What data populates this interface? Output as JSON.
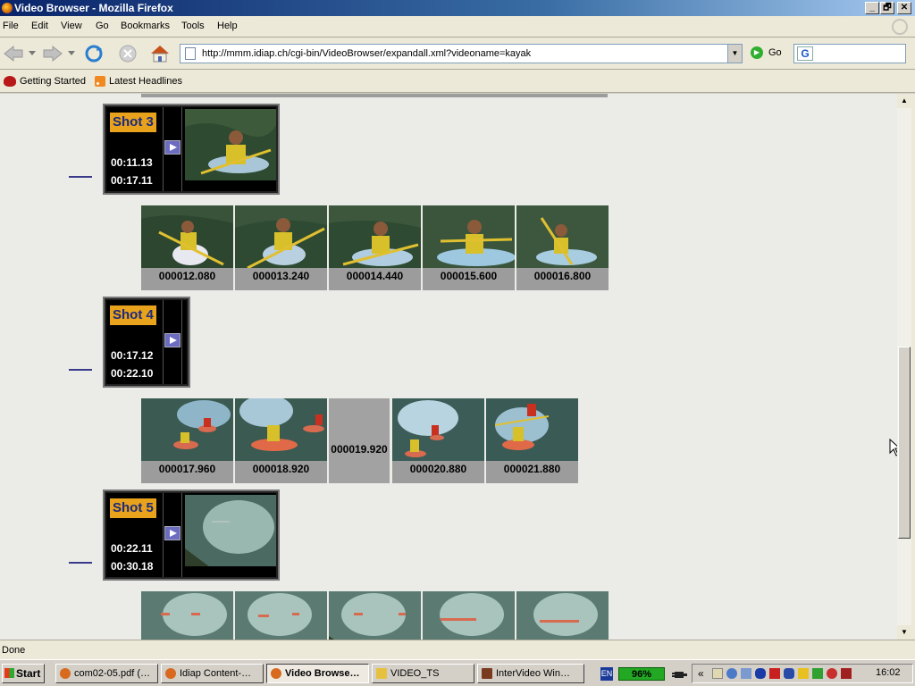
{
  "window": {
    "title": "Video Browser - Mozilla Firefox",
    "min_label": "_",
    "max_label": "🗗",
    "close_label": "✕"
  },
  "menu": [
    "File",
    "Edit",
    "View",
    "Go",
    "Bookmarks",
    "Tools",
    "Help"
  ],
  "nav": {
    "url": "http://mmm.idiap.ch/cgi-bin/VideoBrowser/expandall.xml?videoname=kayak",
    "go_label": "Go",
    "search_value": ""
  },
  "bookmarks": [
    "Getting Started",
    "Latest Headlines"
  ],
  "shots": [
    {
      "label": "Shot 3",
      "start": "00:11.13",
      "end": "00:17.11",
      "has_thumb": true,
      "frames": [
        "000012.080",
        "000013.240",
        "000014.440",
        "000015.600",
        "000016.800"
      ]
    },
    {
      "label": "Shot 4",
      "start": "00:17.12",
      "end": "00:22.10",
      "has_thumb": false,
      "frames": [
        "000017.960",
        "000018.920",
        "000019.920",
        "000020.880",
        "000021.880"
      ]
    },
    {
      "label": "Shot 5",
      "start": "00:22.11",
      "end": "00:30.18",
      "has_thumb": true,
      "frames": []
    }
  ],
  "status": "Done",
  "taskbar": {
    "start": "Start",
    "tasks": [
      "com02-05.pdf (…",
      "Idiap Content-…",
      "Video Browse…",
      "VIDEO_TS",
      "InterVideo Win…"
    ],
    "lang": "EN",
    "battery": "96%",
    "clock": "16:02",
    "tray_arrow": "«"
  },
  "colors": {
    "shot_label_bg": "#e8a21c",
    "shot_label_text": "#1b2a7a",
    "content_bg": "#ebebe8",
    "frame_bg": "#9c9c9c"
  }
}
